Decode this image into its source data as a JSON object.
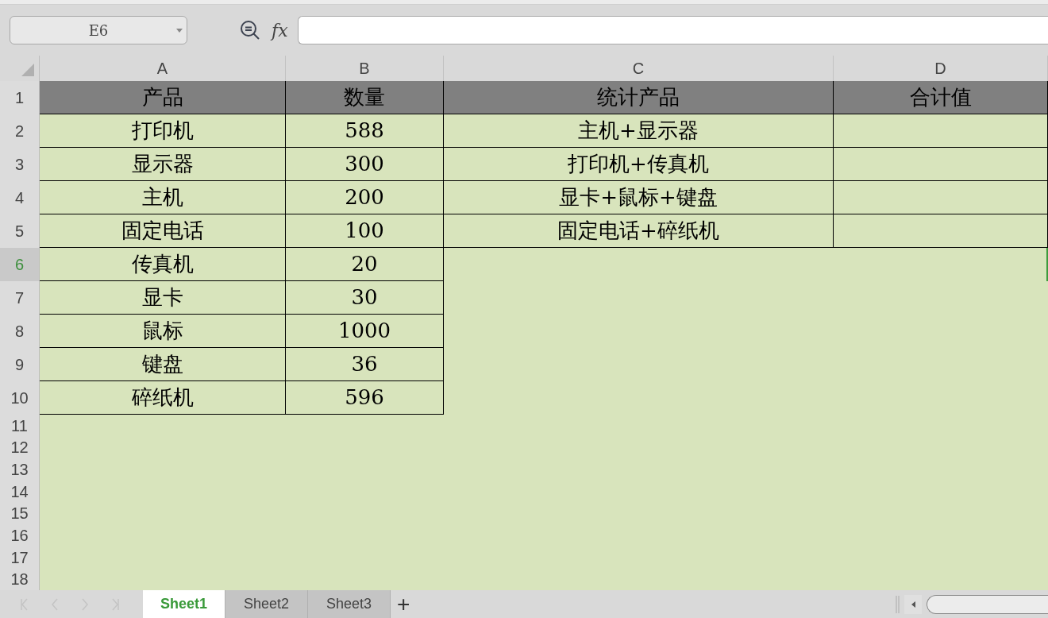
{
  "name_box": {
    "value": "E6"
  },
  "formula_bar": {
    "fx_label": "fx"
  },
  "columns": [
    {
      "label": "A",
      "selected": false
    },
    {
      "label": "B",
      "selected": false
    },
    {
      "label": "C",
      "selected": false
    },
    {
      "label": "D",
      "selected": false
    }
  ],
  "rows": [
    {
      "number": "1",
      "selected": false,
      "cells": [
        {
          "kind": "header",
          "text": "产品"
        },
        {
          "kind": "header",
          "text": "数量"
        },
        {
          "kind": "header",
          "text": "统计产品"
        },
        {
          "kind": "header",
          "text": "合计值"
        }
      ]
    },
    {
      "number": "2",
      "selected": false,
      "cells": [
        {
          "kind": "data",
          "text": "打印机"
        },
        {
          "kind": "data",
          "text": "588"
        },
        {
          "kind": "data",
          "text": "主机+显示器"
        },
        {
          "kind": "blank"
        }
      ]
    },
    {
      "number": "3",
      "selected": false,
      "cells": [
        {
          "kind": "data",
          "text": "显示器"
        },
        {
          "kind": "data",
          "text": "300"
        },
        {
          "kind": "data",
          "text": "打印机+传真机"
        },
        {
          "kind": "blank"
        }
      ]
    },
    {
      "number": "4",
      "selected": false,
      "cells": [
        {
          "kind": "data",
          "text": "主机"
        },
        {
          "kind": "data",
          "text": "200"
        },
        {
          "kind": "data",
          "text": "显卡+鼠标+键盘"
        },
        {
          "kind": "blank"
        }
      ]
    },
    {
      "number": "5",
      "selected": false,
      "cells": [
        {
          "kind": "data",
          "text": "固定电话"
        },
        {
          "kind": "data",
          "text": "100"
        },
        {
          "kind": "data",
          "text": "固定电话+碎纸机"
        },
        {
          "kind": "blank"
        }
      ]
    },
    {
      "number": "6",
      "selected": true,
      "cells": [
        {
          "kind": "data",
          "text": "传真机"
        },
        {
          "kind": "data",
          "text": "20"
        }
      ]
    },
    {
      "number": "7",
      "selected": false,
      "cells": [
        {
          "kind": "data",
          "text": "显卡"
        },
        {
          "kind": "data",
          "text": "30"
        }
      ]
    },
    {
      "number": "8",
      "selected": false,
      "cells": [
        {
          "kind": "data",
          "text": "鼠标"
        },
        {
          "kind": "data",
          "text": "1000"
        }
      ]
    },
    {
      "number": "9",
      "selected": false,
      "cells": [
        {
          "kind": "data",
          "text": "键盘"
        },
        {
          "kind": "data",
          "text": "36"
        }
      ]
    },
    {
      "number": "10",
      "selected": false,
      "cells": [
        {
          "kind": "data",
          "text": "碎纸机"
        },
        {
          "kind": "data",
          "text": "596"
        }
      ]
    },
    {
      "number": "11",
      "selected": false
    },
    {
      "number": "12",
      "selected": false
    },
    {
      "number": "13",
      "selected": false
    },
    {
      "number": "14",
      "selected": false
    },
    {
      "number": "15",
      "selected": false
    },
    {
      "number": "16",
      "selected": false
    },
    {
      "number": "17",
      "selected": false
    },
    {
      "number": "18",
      "selected": false
    }
  ],
  "sheet_tabs": [
    {
      "label": "Sheet1",
      "selected": true
    },
    {
      "label": "Sheet2",
      "selected": false
    },
    {
      "label": "Sheet3",
      "selected": false
    }
  ],
  "add_sheet": {
    "label": "+"
  }
}
